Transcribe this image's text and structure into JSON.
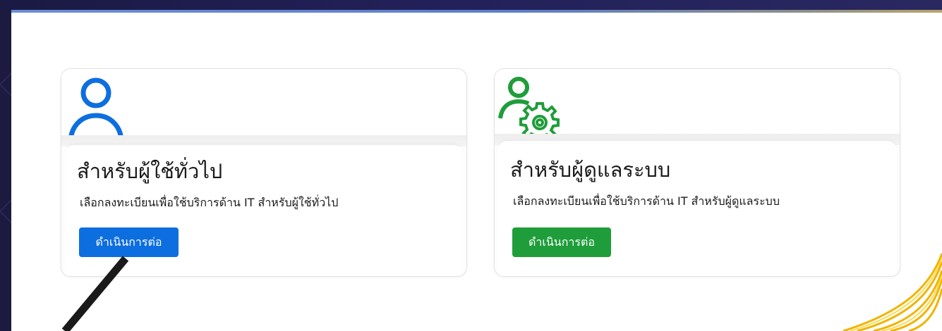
{
  "cards": {
    "user": {
      "title": "สำหรับผู้ใช้ทั่วไป",
      "description": "เลือกลงทะเบียนเพื่อใช้บริการด้าน IT สำหรับผู้ใช้ทั่วไป",
      "button_label": "ดำเนินการต่อ",
      "icon": "user-icon",
      "accent_color": "#0d6ee0"
    },
    "admin": {
      "title": "สำหรับผู้ดูแลระบบ",
      "description": "เลือกลงทะเบียนเพื่อใช้บริการด้าน IT สำหรับผู้ดูแลระบบ",
      "button_label": "ดำเนินการต่อ",
      "icon": "user-gear-icon",
      "accent_color": "#1f9d3a"
    }
  },
  "colors": {
    "background": "#1c1a3e",
    "panel": "#ffffff",
    "primary_button": "#0d6ee0",
    "success_button": "#1f9d3a",
    "gold_accent": "#f0b400"
  }
}
